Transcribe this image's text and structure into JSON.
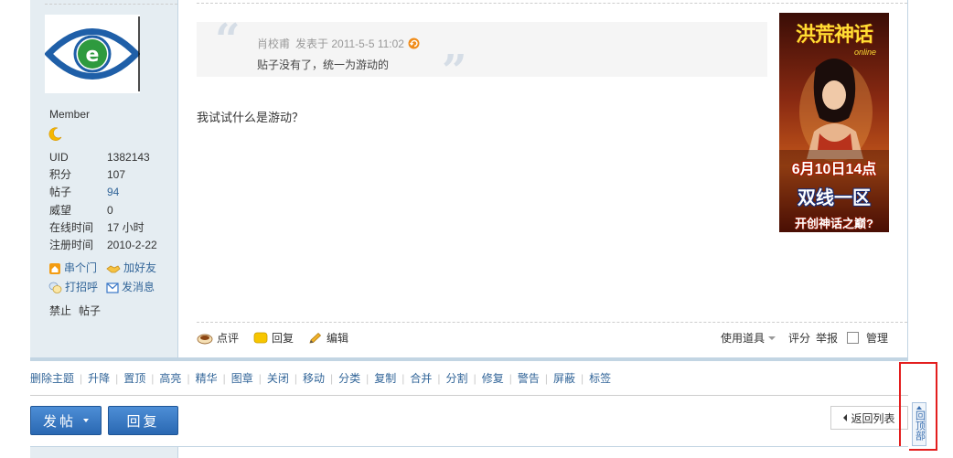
{
  "user": {
    "group": "Member",
    "stats": [
      {
        "label": "UID",
        "value": "1382143"
      },
      {
        "label": "积分",
        "value": "107"
      },
      {
        "label": "帖子",
        "value": "94"
      },
      {
        "label": "威望",
        "value": "0"
      },
      {
        "label": "在线时间",
        "value": "17 小时"
      },
      {
        "label": "注册时间",
        "value": "2010-2-22"
      }
    ],
    "actions": [
      "串个门",
      "加好友",
      "打招呼",
      "发消息"
    ],
    "ban": "禁止",
    "posts": "帖子"
  },
  "quote": {
    "author": "肖校甫",
    "posted_at": "发表于 2011-5-5 11:02",
    "text": "贴子没有了，统一为游动的"
  },
  "post": {
    "text": "我试试什么是游动？"
  },
  "ad": {
    "title": "洪荒神话",
    "subtitle": "online",
    "date": "6月10日14点",
    "line": "双线一区",
    "slogan": "开创神话之巅?"
  },
  "post_tools": {
    "comment": "点评",
    "reply": "回复",
    "edit": "编辑",
    "use_item": "使用道具",
    "rate": "评分",
    "report": "举报",
    "manage": "管理"
  },
  "mod_actions": [
    "删除主题",
    "升降",
    "置顶",
    "高亮",
    "精华",
    "图章",
    "关闭",
    "移动",
    "分类",
    "复制",
    "合并",
    "分割",
    "修复",
    "警告",
    "屏蔽",
    "标签"
  ],
  "buttons": {
    "new_post": "发帖",
    "reply": "回复",
    "back_to_list": "返回列表",
    "back_to_top": "回顶部"
  },
  "colors": {
    "link": "#336699",
    "sidebar_bg": "#e5edf2",
    "border": "#c2d5e3",
    "button_blue": "#2a68b2",
    "highlight_red": "#e31e1e"
  }
}
